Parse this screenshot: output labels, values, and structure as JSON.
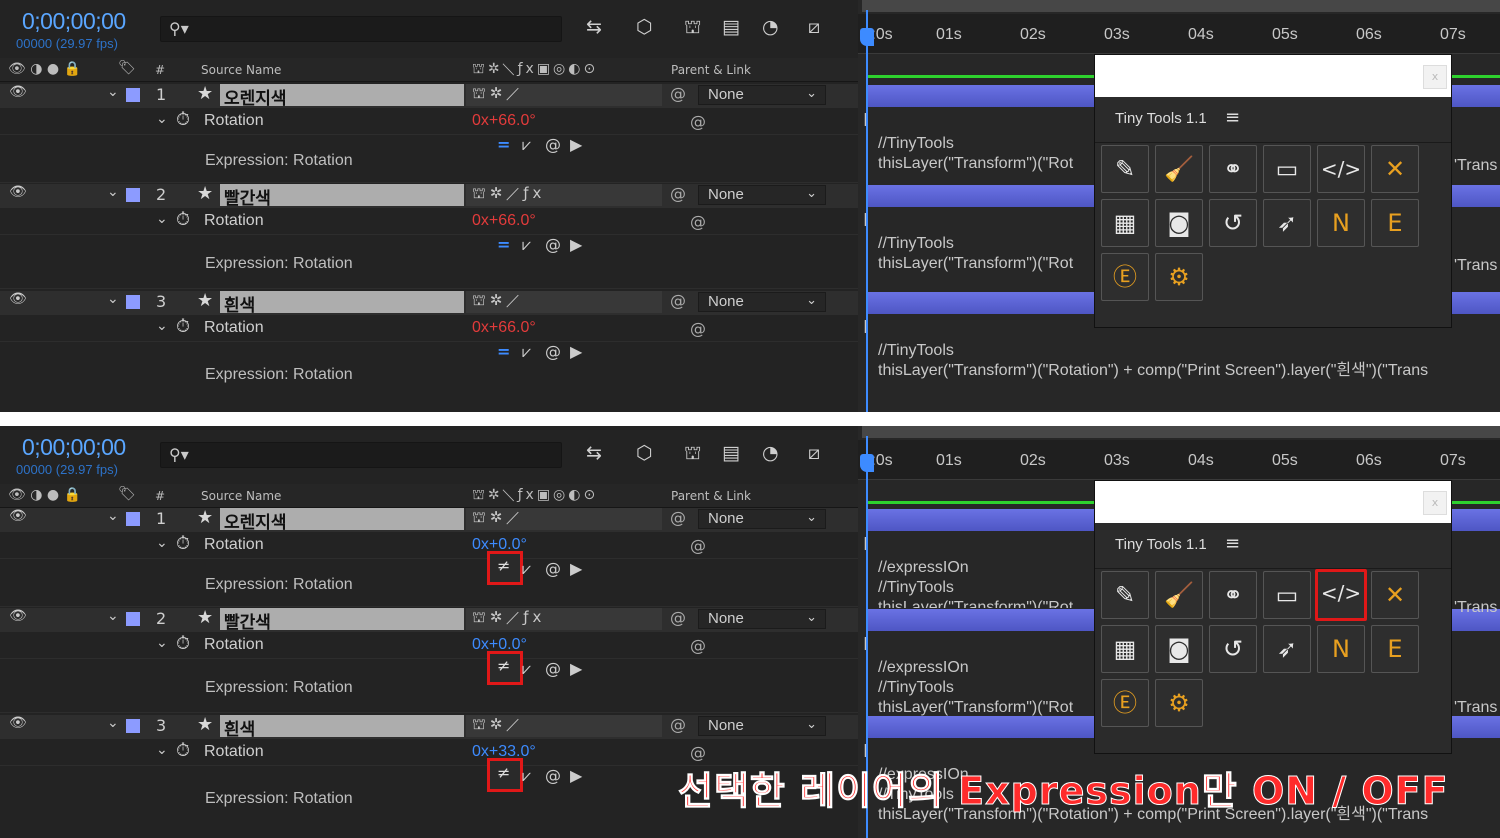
{
  "timeline": {
    "timecode": "0;00;00;00",
    "fps": "00000 (29.97 fps)",
    "search_glyph": "⚲▾",
    "header": {
      "source_name": "Source Name",
      "parent_link": "Parent & Link",
      "col_marker": "#"
    },
    "ruler": [
      "0s",
      "01s",
      "02s",
      "03s",
      "04s",
      "05s",
      "06s",
      "07s"
    ],
    "ruler_display": [
      "):0s",
      "01s",
      "02s",
      "03s",
      "04s",
      "05s",
      "06s",
      "07s"
    ]
  },
  "panels": [
    {
      "layers": [
        {
          "num": "1",
          "name": "오렌지색",
          "parent": "None",
          "prop": "Rotation",
          "value": "0x+66.0°",
          "expr_label": "Expression: Rotation",
          "expr_lines": [
            "//TinyTools",
            "thisLayer(\"Transform\")(\"Rot"
          ]
        },
        {
          "num": "2",
          "name": "빨간색",
          "parent": "None",
          "prop": "Rotation",
          "value": "0x+66.0°",
          "expr_label": "Expression: Rotation",
          "expr_lines": [
            "//TinyTools",
            "thisLayer(\"Transform\")(\"Rot"
          ]
        },
        {
          "num": "3",
          "name": "흰색",
          "parent": "None",
          "prop": "Rotation",
          "value": "0x+66.0°",
          "expr_label": "Expression: Rotation",
          "expr_lines": [
            "//TinyTools",
            "thisLayer(\"Transform\")(\"Rotation\") + comp(\"Print Screen\").layer(\"흰색\")(\"Trans"
          ]
        }
      ],
      "side_text": [
        "'Trans",
        "'Trans"
      ]
    },
    {
      "layers": [
        {
          "num": "1",
          "name": "오렌지색",
          "parent": "None",
          "prop": "Rotation",
          "value": "0x+0.0°",
          "expr_label": "Expression: Rotation",
          "expr_lines": [
            "//expressIOn",
            "//TinyTools",
            "thisLayer(\"Transform\")(\"Rot"
          ]
        },
        {
          "num": "2",
          "name": "빨간색",
          "parent": "None",
          "prop": "Rotation",
          "value": "0x+0.0°",
          "expr_label": "Expression: Rotation",
          "expr_lines": [
            "//expressIOn",
            "//TinyTools",
            "thisLayer(\"Transform\")(\"Rot"
          ]
        },
        {
          "num": "3",
          "name": "흰색",
          "parent": "None",
          "prop": "Rotation",
          "value": "0x+33.0°",
          "expr_label": "Expression: Rotation",
          "expr_lines": [
            "//expressIOn",
            "//TinyTools",
            "thisLayer(\"Transform\")(\"Rotation\") + comp(\"Print Screen\").layer(\"흰색\")(\"Trans"
          ]
        }
      ],
      "side_text": [
        "'Trans",
        "'Trans"
      ]
    }
  ],
  "tinytools": {
    "title": "Tiny Tools 1.1",
    "menu_glyph": "≡",
    "close_glyph": "x",
    "buttons": [
      {
        "icon": "eyedropper-icon",
        "glyph": "✎"
      },
      {
        "icon": "broom-icon",
        "glyph": "🧹"
      },
      {
        "icon": "nodes-icon",
        "glyph": "⚭"
      },
      {
        "icon": "film-icon",
        "glyph": "▭"
      },
      {
        "icon": "code-icon",
        "glyph": "</>"
      },
      {
        "icon": "chevron-icon",
        "glyph": "✕"
      },
      {
        "icon": "calculator-icon",
        "glyph": "▦"
      },
      {
        "icon": "camera-icon",
        "glyph": "◙"
      },
      {
        "icon": "history-icon",
        "glyph": "↺"
      },
      {
        "icon": "rocket-icon",
        "glyph": "➶"
      },
      {
        "icon": "null-swap-icon",
        "glyph": "N"
      },
      {
        "icon": "expression-swap-icon",
        "glyph": "E"
      },
      {
        "icon": "expression-search-icon",
        "glyph": "Ⓔ"
      },
      {
        "icon": "settings-gear-icon",
        "glyph": "⚙"
      }
    ],
    "selected_in_bottom": 4
  },
  "caption": "선택한 레이어의 Expression만 ON / OFF",
  "colors": {
    "accent": "#3d8bff",
    "highlight": "#e01818",
    "layer_bar": "#5b63d6"
  }
}
